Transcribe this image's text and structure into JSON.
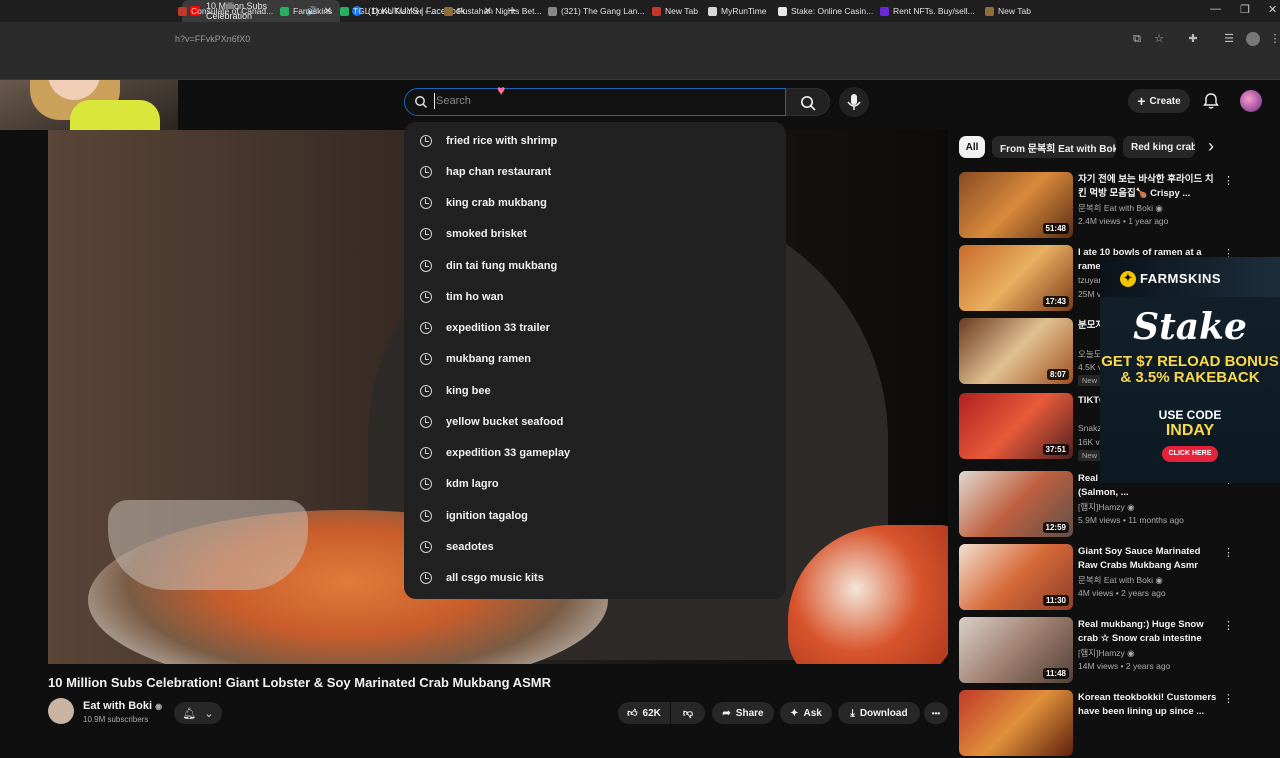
{
  "browser": {
    "tabs": [
      {
        "title": "10 Million Subs Celebration",
        "close": "✕"
      },
      {
        "title": "(1) KUKUYS | Facebook",
        "close": "✕"
      }
    ],
    "new_tab": "+",
    "url": "h?v=FFvkPXn6fX0",
    "bookmarks": [
      "Consulate of Canad...",
      "Farmskins",
      "TGL Dono Tracker -...",
      "Pustahan Nights Bet...",
      "(321) The Gang Lan...",
      "New Tab",
      "MyRunTime",
      "Stake: Online Casin...",
      "Rent NFTs. Buy/sell...",
      "New Tab"
    ],
    "window_controls": [
      "—",
      "❐",
      "✕"
    ]
  },
  "header": {
    "search_placeholder": "Search",
    "create_label": "Create",
    "create_icon": "+"
  },
  "suggestions": [
    "fried rice with shrimp",
    "hap chan restaurant",
    "king crab mukbang",
    "smoked brisket",
    "din tai fung mukbang",
    "tim ho wan",
    "expedition 33 trailer",
    "mukbang ramen",
    "king bee",
    "yellow bucket seafood",
    "expedition 33 gameplay",
    "kdm lagro",
    "ignition tagalog",
    "seadotes",
    "all csgo music kits"
  ],
  "video": {
    "title": "10 Million Subs Celebration! Giant Lobster & Soy Marinated Crab Mukbang ASMR",
    "channel": "Eat with Boki",
    "verified": "◉",
    "subs": "10.9M subscribers",
    "actions": {
      "likes": "62K",
      "share": "Share",
      "ask": "Ask",
      "download": "Download",
      "more": "•••"
    }
  },
  "chips": [
    "All",
    "From 문복희 Eat with Boki",
    "Red king crabs"
  ],
  "chips_next": "›",
  "recommendations": [
    {
      "title": "자기 전에 보는 바삭한 후라이드 치킨 먹방 모음집🍗 Crispy ...",
      "channel": "문복희 Eat with Boki ◉",
      "meta": "2.4M views • 1 year ago",
      "duration": "51:48",
      "new": ""
    },
    {
      "title": "I ate 10 bowls of ramen at a ramen...",
      "channel": "tzuyang...",
      "meta": "25M vi...",
      "duration": "17:43",
      "new": ""
    },
    {
      "title": "분모자 임 지...",
      "channel": "오늘도...",
      "meta": "4.5K v...",
      "duration": "8:07",
      "new": "New"
    },
    {
      "title": "TIKTO Domi...",
      "channel": "Snakz...",
      "meta": "16K vi...",
      "duration": "37:51",
      "new": "New"
    },
    {
      "title": "Real Marinated Seafood (Salmon, ...",
      "channel": "[햄지]Hamzy ◉",
      "meta": "5.9M views • 11 months ago",
      "duration": "12:59",
      "new": ""
    },
    {
      "title": "Giant Soy Sauce Marinated Raw Crabs Mukbang Asmr",
      "channel": "문복희 Eat with Boki ◉",
      "meta": "4M views • 2 years ago",
      "duration": "11:30",
      "new": ""
    },
    {
      "title": "Real mukbang:) Huge Snow crab ☆ Snow crab intestine fri...",
      "channel": "[햄지]Hamzy ◉",
      "meta": "14M views • 2 years ago",
      "duration": "11:48",
      "new": ""
    },
    {
      "title": "Korean tteokbokki! Customers have been lining up since ...",
      "channel": "",
      "meta": "",
      "duration": "",
      "new": ""
    }
  ],
  "ad": {
    "brand": "FARMSKINS",
    "logo": "Stake",
    "offer": "GET $7 RELOAD BONUS & 3.5% RAKEBACK",
    "use_code": "USE CODE",
    "code": "INDAY",
    "cta": "CLICK HERE"
  },
  "colors": {
    "background": "#0f0f0f",
    "dropdown": "#212121",
    "accent_blue": "#1c62b9",
    "youtube_red": "#ff0000",
    "ad_yellow": "#f9d849"
  }
}
